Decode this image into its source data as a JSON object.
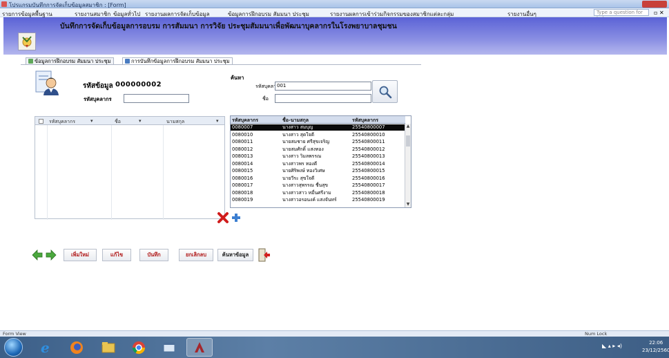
{
  "window": {
    "title": "โปรแกรมบันทึกการจัดเก็บข้อมูลสมาชิก : [Form]"
  },
  "menu": {
    "items": [
      {
        "label": "รายการข้อมูลพื้นฐาน"
      },
      {
        "label": "รายงานสมาชิก"
      },
      {
        "label": "ข้อมูลทั่วไป"
      },
      {
        "label": "รายงานผลการจัดเก็บข้อมูล"
      },
      {
        "label": "ข้อมูลการฝึกอบรม สัมมนา ประชุม"
      },
      {
        "label": "รายงานผลการเข้าร่วมกิจกรรมของสมาชิกแต่ละกลุ่ม"
      },
      {
        "label": "รายงานอื่นๆ"
      }
    ],
    "help_placeholder": "Type a question for help"
  },
  "header": {
    "title": "บันทึกการจัดเก็บข้อมูลการอบรม การสัมมนา การวิจัย ประชุมสัมมนาเพื่อพัฒนาบุคลากรในโรงพยาบาลชุมชน"
  },
  "tabs": [
    {
      "label": "ข้อมูลการฝึกอบรม สัมมนา ประชุม"
    },
    {
      "label": "การบันทึกข้อมูลการฝึกอบรม สัมมนา ประชุม"
    }
  ],
  "form": {
    "record_no_label": "รหัสข้อมูล",
    "record_no_value": "000000002",
    "member_label": "รหัสบุคลากร",
    "search": {
      "title": "ค้นหา",
      "code_label": "รหัสบุคลากร",
      "code_value": "001",
      "name_label": "ชื่อ"
    }
  },
  "left_grid": {
    "columns": [
      "รหัสบุคลากร",
      "ชื่อ",
      "นามสกุล"
    ]
  },
  "right_list": {
    "columns": [
      "รหัสบุคลากร",
      "ชื่อ-นามสกุล",
      "รหัสบุคลากร"
    ],
    "rows": [
      {
        "code": "0080007",
        "name": "นางสาว สมบุญ",
        "id": "25540800007"
      },
      {
        "code": "0080010",
        "name": "นางสาว สุดใจดี",
        "id": "25540800010"
      },
      {
        "code": "0080011",
        "name": "นายสมชาย ศรีสุขเจริญ",
        "id": "25540800011"
      },
      {
        "code": "0080012",
        "name": "นายสมศักดิ์ แสงทอง",
        "id": "25540800012"
      },
      {
        "code": "0080013",
        "name": "นางสาว วิมลพรรณ",
        "id": "25540800013"
      },
      {
        "code": "0080014",
        "name": "นางสาวพร ทองดี",
        "id": "25540800014"
      },
      {
        "code": "0080015",
        "name": "นายศิริพงษ์ ทองวิเศษ",
        "id": "25540800015"
      },
      {
        "code": "0080016",
        "name": "นายวีระ สุขใจดี",
        "id": "25540800016"
      },
      {
        "code": "0080017",
        "name": "นางสาวสุพรรณ ชื่นสุข",
        "id": "25540800017"
      },
      {
        "code": "0080018",
        "name": "นางสาวสาว หมื่นศรีงาม",
        "id": "25540800018"
      },
      {
        "code": "0080019",
        "name": "นางสาวอรอนงค์ แสงจันทร์",
        "id": "25540800019"
      }
    ],
    "selected_index": 0
  },
  "toolbar": {
    "buttons": [
      {
        "label": "เพิ่มใหม่"
      },
      {
        "label": "แก้ไข"
      },
      {
        "label": "บันทึก"
      },
      {
        "label": "ยกเลิกลบ"
      },
      {
        "label": "ค้นหาข้อมูล"
      }
    ]
  },
  "statusbar": {
    "left": "Form View",
    "right": "Num Lock"
  },
  "taskbar": {
    "clock_time": "22:06",
    "clock_date": "23/12/2560"
  },
  "colors": {
    "header_top": "#5b63d6",
    "header_bottom": "#b4b7ee",
    "selected_row": "#0a0a0a",
    "button_text": "#b01818"
  }
}
